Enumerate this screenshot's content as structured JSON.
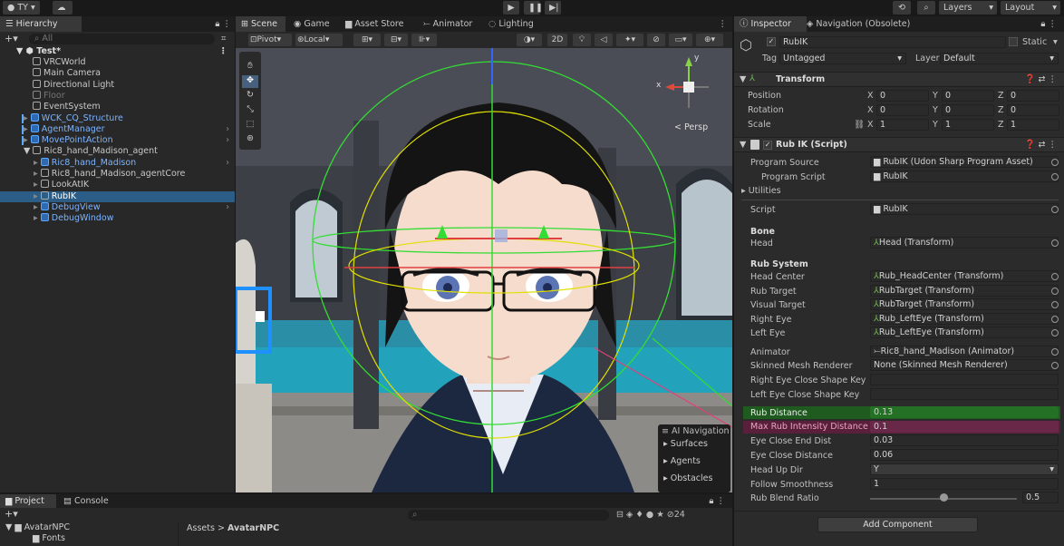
{
  "topbar": {
    "account": "TY",
    "layers": "Layers",
    "layout": "Layout"
  },
  "hierarchy": {
    "tab": "Hierarchy",
    "search_placeholder": "All",
    "scene": "Test*",
    "items": [
      {
        "label": "VRCWorld",
        "depth": 1,
        "style": "normal"
      },
      {
        "label": "Main Camera",
        "depth": 1,
        "style": "normal"
      },
      {
        "label": "Directional Light",
        "depth": 1,
        "style": "normal"
      },
      {
        "label": "Floor",
        "depth": 1,
        "style": "disabled"
      },
      {
        "label": "EventSystem",
        "depth": 1,
        "style": "normal"
      },
      {
        "label": "WCK_CQ_Structure",
        "depth": 1,
        "style": "prefab"
      },
      {
        "label": "AgentManager",
        "depth": 1,
        "style": "prefab"
      },
      {
        "label": "MovePointAction",
        "depth": 1,
        "style": "prefab"
      },
      {
        "label": "Ric8_hand_Madison_agent",
        "depth": 1,
        "style": "normal"
      },
      {
        "label": "Ric8_hand_Madison",
        "depth": 2,
        "style": "prefab"
      },
      {
        "label": "Ric8_hand_Madison_agentCore",
        "depth": 2,
        "style": "normal"
      },
      {
        "label": "LookAtIK",
        "depth": 2,
        "style": "normal"
      },
      {
        "label": "RubIK",
        "depth": 2,
        "style": "selected"
      },
      {
        "label": "DebugView",
        "depth": 2,
        "style": "prefab"
      },
      {
        "label": "DebugWindow",
        "depth": 2,
        "style": "prefab"
      }
    ]
  },
  "scene_tabs": [
    "Scene",
    "Game",
    "Asset Store",
    "Animator",
    "Lighting"
  ],
  "scene_toolbar": {
    "pivot": "Pivot",
    "local": "Local",
    "mode2d": "2D"
  },
  "scene_view": {
    "persp": "< Persp",
    "gizmo_x": "x",
    "gizmo_y": "y"
  },
  "ai_nav": {
    "title": "AI Navigation",
    "items": [
      "Surfaces",
      "Agents",
      "Obstacles"
    ]
  },
  "bottom": {
    "tab_project": "Project",
    "tab_console": "Console",
    "tree": [
      "AvatarNPC",
      "Fonts"
    ],
    "breadcrumb_root": "Assets",
    "breadcrumb_sep": ">",
    "breadcrumb_leaf": "AvatarNPC",
    "hidden_count": "24"
  },
  "inspector": {
    "tab1": "Inspector",
    "tab2": "Navigation (Obsolete)",
    "object_name": "RubIK",
    "static_label": "Static",
    "tag_label": "Tag",
    "tag_value": "Untagged",
    "layer_label": "Layer",
    "layer_value": "Default",
    "transform_title": "Transform",
    "transform_rows": [
      {
        "label": "Position",
        "x": "0",
        "y": "0",
        "z": "0"
      },
      {
        "label": "Rotation",
        "x": "0",
        "y": "0",
        "z": "0"
      },
      {
        "label": "Scale",
        "x": "1",
        "y": "1",
        "z": "1"
      }
    ],
    "script_title": "Rub IK (Script)",
    "program_source_label": "Program Source",
    "program_source_value": "RubIK (Udon Sharp Program Asset)",
    "program_script_label": "Program Script",
    "program_script_value": "RubIK",
    "utilities_label": "Utilities",
    "script_label": "Script",
    "script_value": "RubIK",
    "bone_header": "Bone",
    "head_label": "Head",
    "head_value": "Head (Transform)",
    "rub_system_header": "Rub System",
    "rub_rows": [
      {
        "label": "Head Center",
        "value": "Rub_HeadCenter (Transform)"
      },
      {
        "label": "Rub Target",
        "value": "RubTarget (Transform)"
      },
      {
        "label": "Visual Target",
        "value": "RubTarget (Transform)"
      },
      {
        "label": "Right Eye",
        "value": "Rub_LeftEye (Transform)"
      },
      {
        "label": "Left Eye",
        "value": "Rub_LeftEye (Transform)"
      }
    ],
    "animator_label": "Animator",
    "animator_value": "Ric8_hand_Madison (Animator)",
    "smr_label": "Skinned Mesh Renderer",
    "smr_value": "None (Skinned Mesh Renderer)",
    "re_close_label": "Right Eye Close Shape Key",
    "le_close_label": "Left Eye Close Shape Key",
    "rub_distance_label": "Rub Distance",
    "rub_distance_value": "0.13",
    "max_rub_label": "Max Rub Intensity Distance",
    "max_rub_value": "0.1",
    "eye_end_label": "Eye Close End Dist",
    "eye_end_value": "0.03",
    "eye_dist_label": "Eye Close Distance",
    "eye_dist_value": "0.06",
    "head_up_label": "Head Up Dir",
    "head_up_value": "Y",
    "follow_label": "Follow Smoothness",
    "follow_value": "1",
    "blend_label": "Rub Blend Ratio",
    "blend_value": "0.5",
    "blend_fraction": 0.5,
    "add_component": "Add Component"
  }
}
